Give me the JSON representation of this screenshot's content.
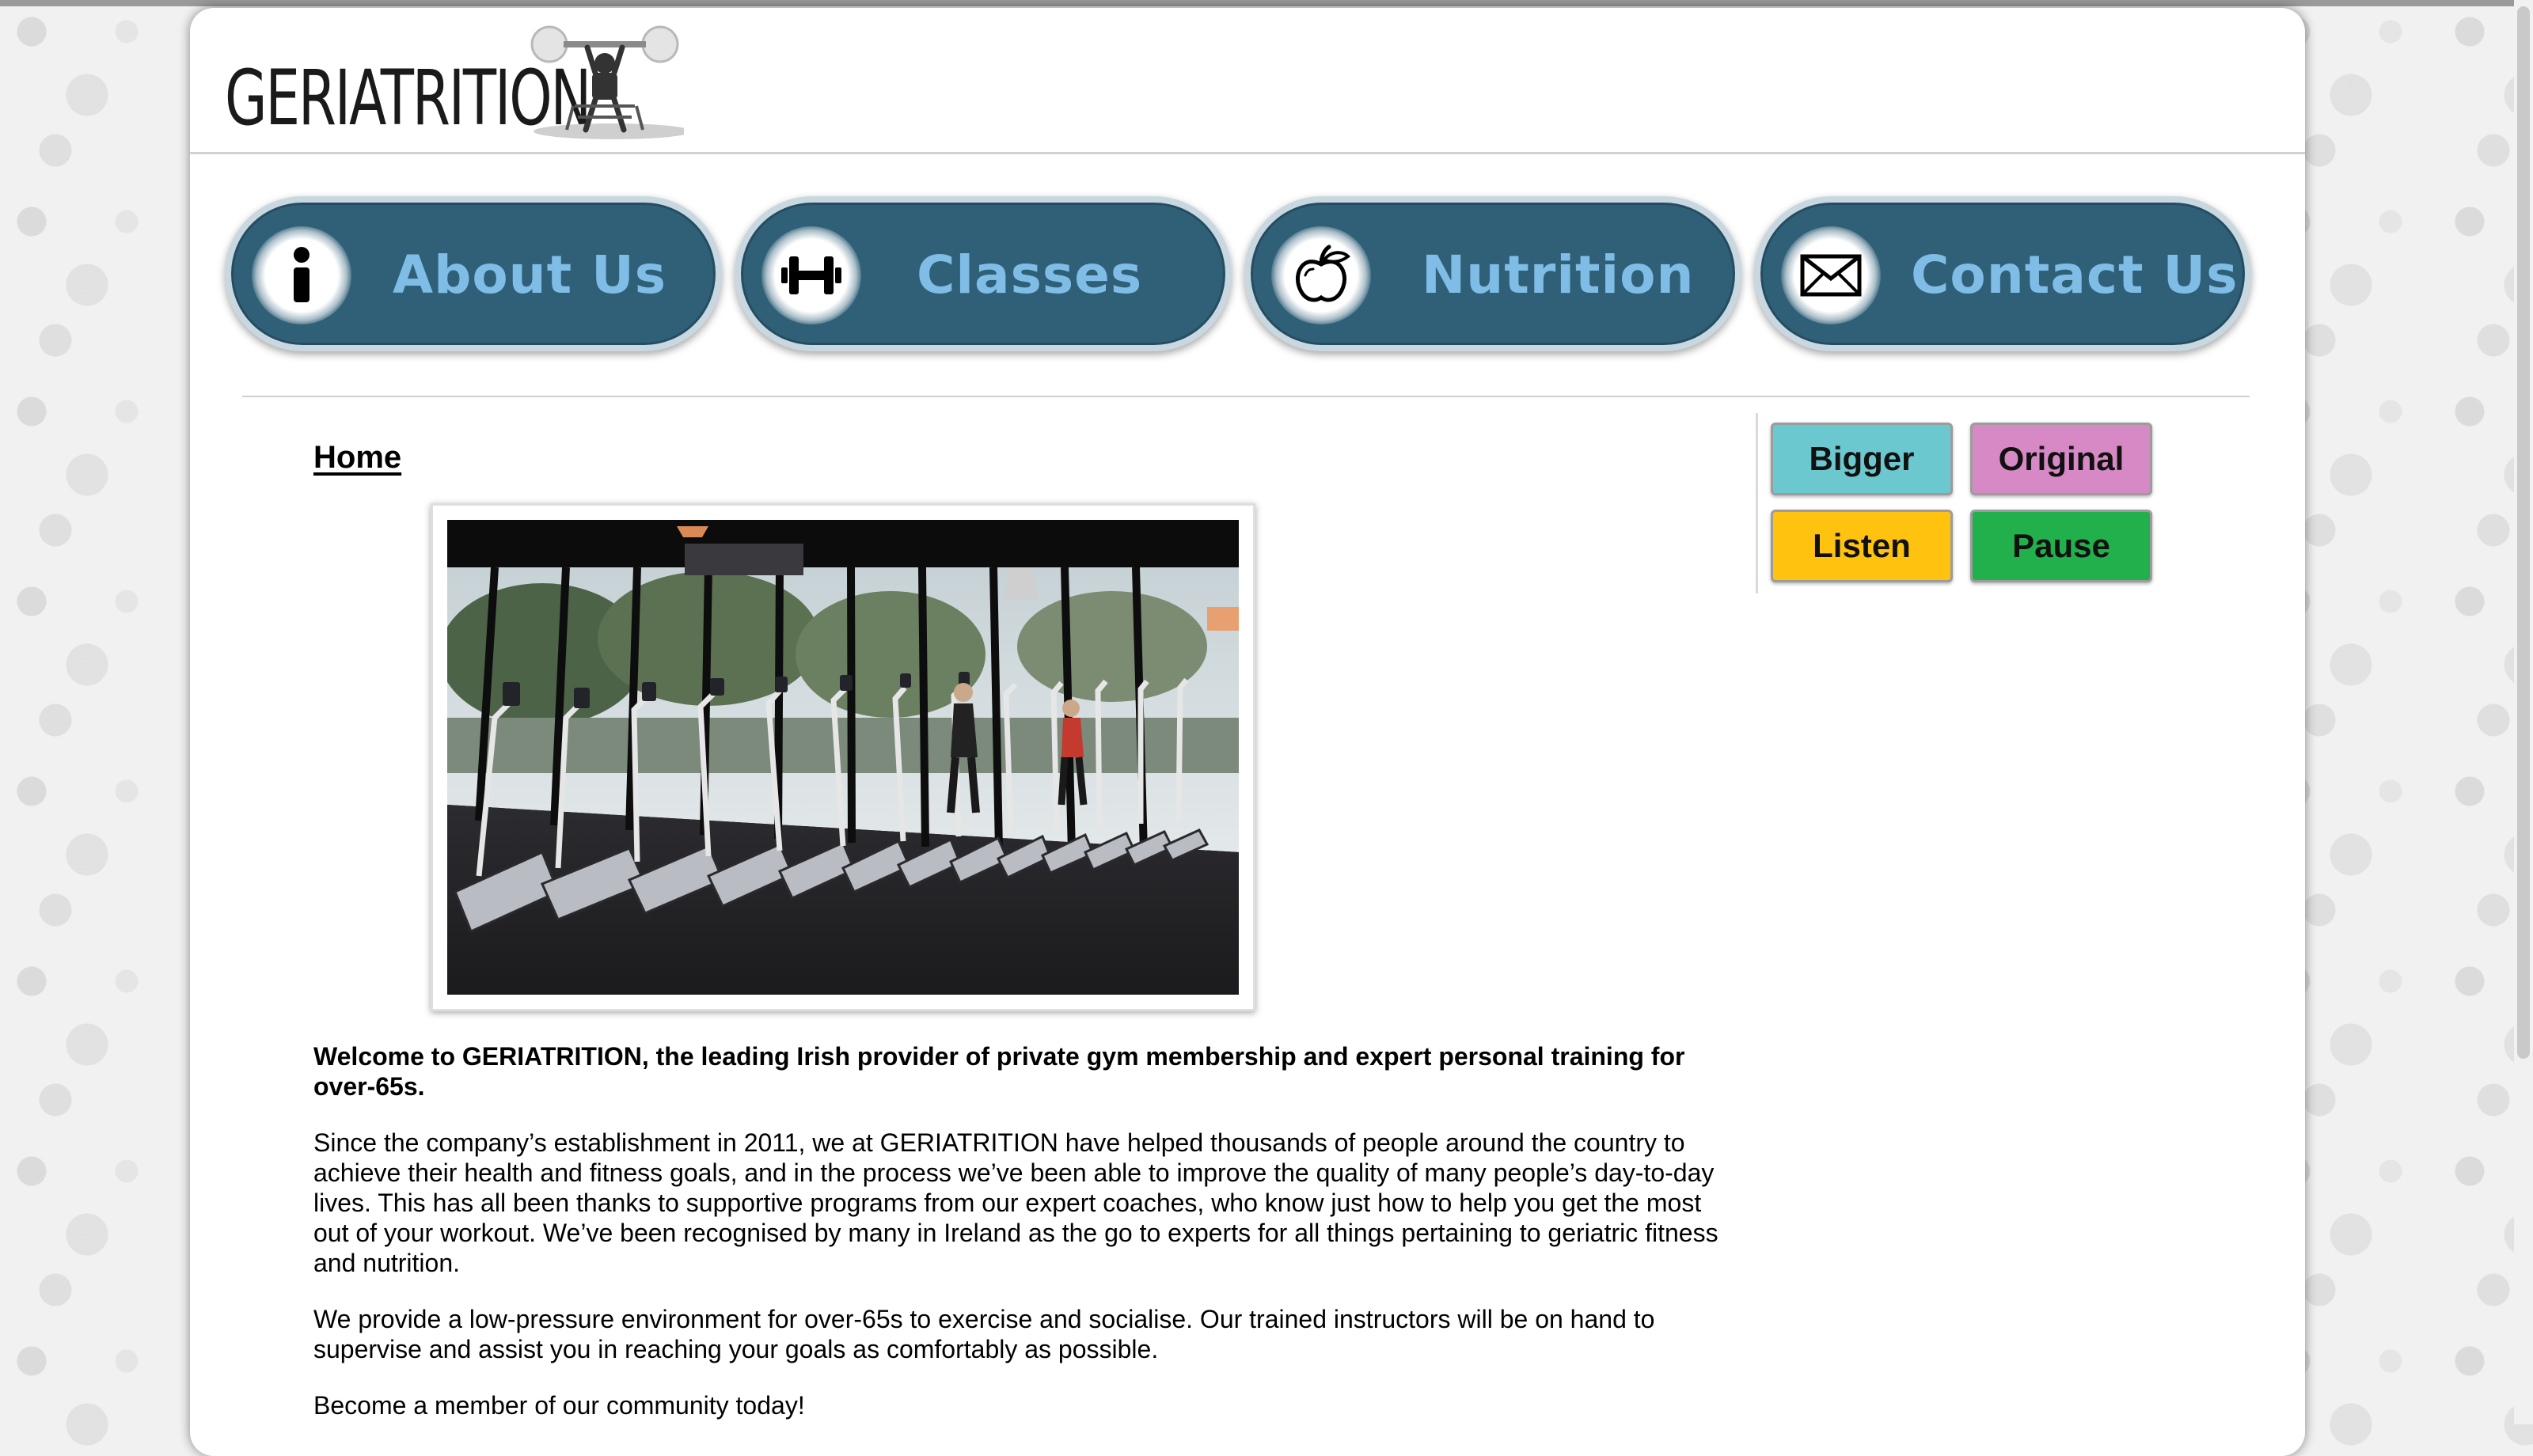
{
  "site": {
    "logo_text": "GERIATRITION"
  },
  "nav": {
    "items": [
      {
        "label": "About Us",
        "icon": "info-icon"
      },
      {
        "label": "Classes",
        "icon": "dumbbell-icon"
      },
      {
        "label": "Nutrition",
        "icon": "apple-icon"
      },
      {
        "label": "Contact Us",
        "icon": "envelope-icon"
      }
    ]
  },
  "breadcrumb": {
    "current": "Home"
  },
  "hero_image": {
    "alt": "Gym floor with rows of elliptical trainers in front of tall windows"
  },
  "content": {
    "intro": "Welcome to GERIATRITION, the leading Irish provider of private gym membership and expert personal training for over-65s.",
    "paragraph_2": "Since the company’s establishment in 2011, we at GERIATRITION have helped thousands of people around the country to achieve their health and fitness goals, and in the process we’ve been able to improve the quality of many people’s day-to-day lives. This has all been thanks to supportive programs from our expert coaches, who know just how to help you get the most out of your workout. We’ve been recognised by many in Ireland as the go to experts for all things pertaining to geriatric fitness and nutrition.",
    "paragraph_3": "We provide a low-pressure environment for over-65s to exercise and socialise. Our trained instructors will be on hand to supervise and assist you in reaching your goals as comfortably as possible.",
    "paragraph_4": "Become a member of our community today!"
  },
  "accessibility": {
    "bigger": {
      "label": "Bigger",
      "color": "#6cc8cf"
    },
    "original": {
      "label": "Original",
      "color": "#d689c4"
    },
    "listen": {
      "label": "Listen",
      "color": "#ffc20e"
    },
    "pause": {
      "label": "Pause",
      "color": "#21b04b"
    }
  },
  "theme": {
    "nav_fill": "#306078",
    "nav_text": "#7fbde6"
  }
}
